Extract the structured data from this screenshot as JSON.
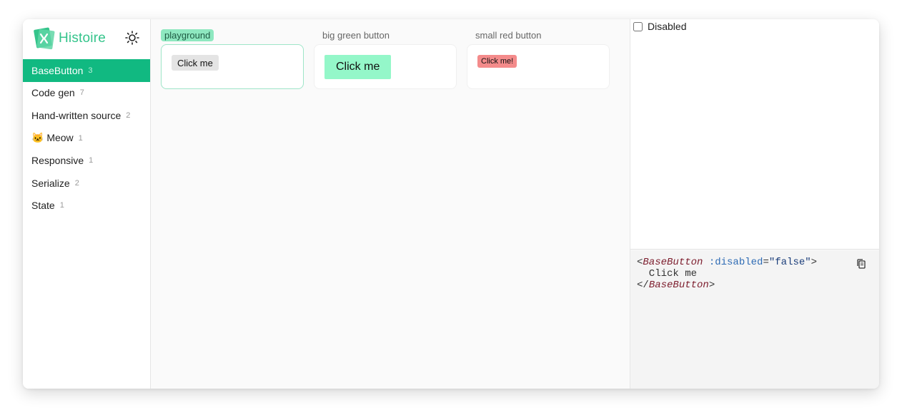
{
  "app": {
    "brand": "Histoire",
    "accent": "#11b981"
  },
  "sidebar": {
    "items": [
      {
        "label": "BaseButton",
        "count": "3",
        "active": true
      },
      {
        "label": "Code gen",
        "count": "7"
      },
      {
        "label": "Hand-written source",
        "count": "2"
      },
      {
        "label": "🐱 Meow",
        "count": "1"
      },
      {
        "label": "Responsive",
        "count": "1"
      },
      {
        "label": "Serialize",
        "count": "2"
      },
      {
        "label": "State",
        "count": "1"
      }
    ]
  },
  "variants": [
    {
      "title": "playground",
      "button_label": "Click me",
      "selected": true
    },
    {
      "title": "big green button",
      "button_label": "Click me"
    },
    {
      "title": "small red button",
      "button_label": "Click me!"
    }
  ],
  "controls": {
    "disabled_label": "Disabled",
    "disabled_checked": false
  },
  "code": {
    "open_lt": "<",
    "component": "BaseButton",
    "attr": ":disabled",
    "eq": "=",
    "value": "\"false\"",
    "open_gt": ">",
    "content": "  Click me",
    "close_lt": "</",
    "close_gt": ">"
  }
}
